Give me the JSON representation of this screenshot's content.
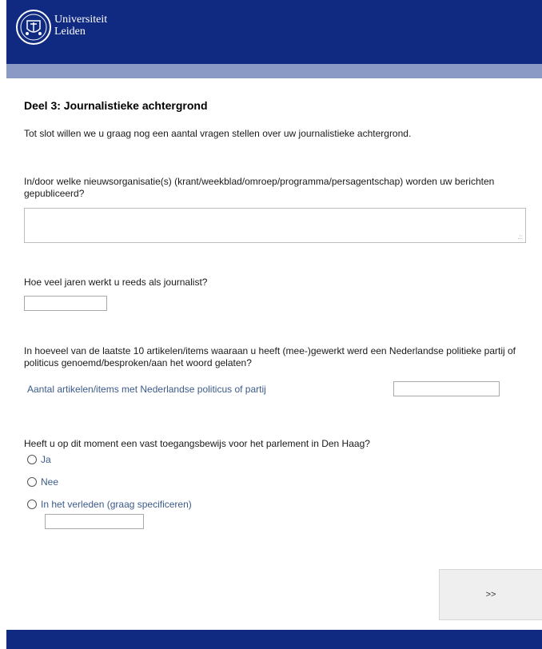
{
  "header": {
    "logo_line1": "Universiteit",
    "logo_line2": "Leiden",
    "colors": {
      "header": "#0f2a80",
      "subbar": "#8b9ac4",
      "footer": "#0f2a80"
    }
  },
  "section": {
    "title": "Deel 3: Journalistieke achtergrond",
    "intro": "Tot slot willen we u graag nog een aantal vragen stellen over uw journalistieke achtergrond."
  },
  "questions": {
    "q1": "In/door welke nieuwsorganisatie(s) (krant/weekblad/omroep/programma/persagentschap) worden uw berichten gepubliceerd?",
    "q1_value": "",
    "q2": "Hoe veel jaren werkt u reeds als journalist?",
    "q2_value": "",
    "q3": "In hoeveel van de laatste 10 artikelen/items waaraan u heeft (mee-)gewerkt werd een Nederlandse politieke partij of politicus genoemd/besproken/aan het woord gelaten?",
    "q3_sublabel": "Aantal artikelen/items met Nederlandse politicus of partij",
    "q3_value": "",
    "q4": "Heeft u op dit moment een vast toegangsbewijs voor het parlement in Den Haag?",
    "q4_options": [
      "Ja",
      "Nee",
      "In het verleden (graag specificeren)"
    ],
    "q4_specify_value": ""
  },
  "navigation": {
    "next_label": ">>"
  }
}
